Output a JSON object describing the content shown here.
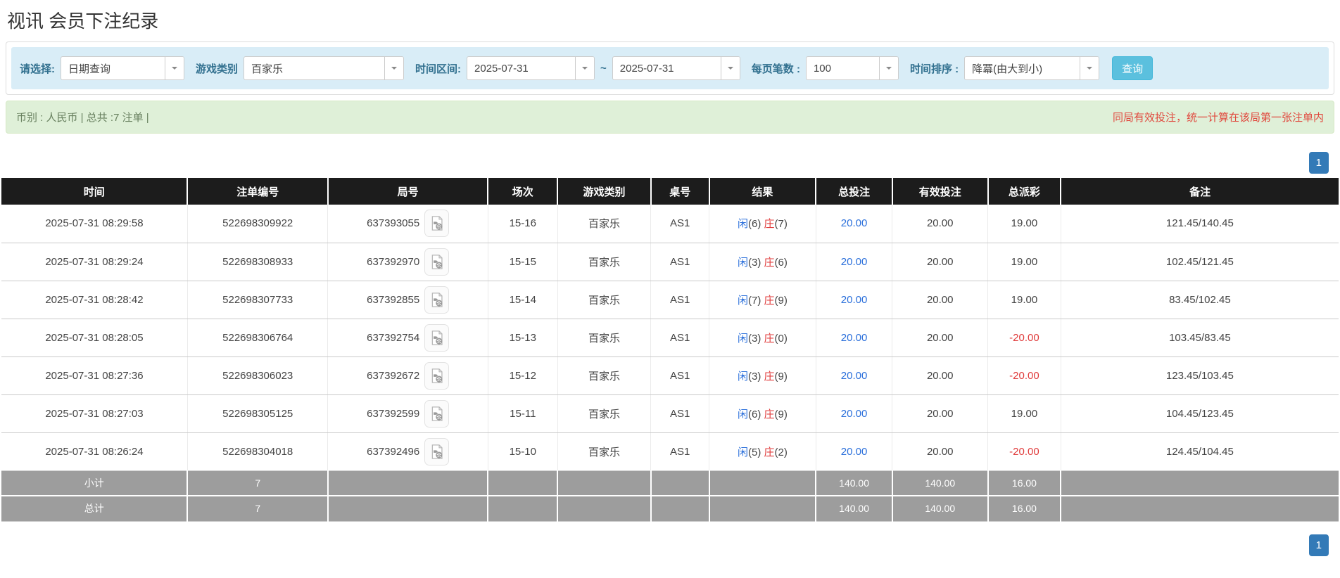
{
  "page": {
    "title": "视讯 会员下注纪录"
  },
  "filters": {
    "select_label": "请选择:",
    "select_value": "日期查询",
    "game_type_label": "游戏类别",
    "game_type_value": "百家乐",
    "time_range_label": "时间区间:",
    "time_from": "2025-07-31",
    "time_separator": "~",
    "time_to": "2025-07-31",
    "page_size_label": "每页笔数 :",
    "page_size_value": "100",
    "sort_label": "时间排序 :",
    "sort_value": "降冪(由大到小)",
    "search_button_label": "查询"
  },
  "summary_bar": {
    "left": "币别 : 人民币 | 总共 :7 注单 |",
    "right": "同局有效投注，统一计算在该局第一张注单内"
  },
  "pagination": {
    "page": "1"
  },
  "colors": {
    "accent_blue": "#337ab7",
    "info_bar_bg": "#d9edf7",
    "success_bar_bg": "#dff0d8",
    "query_button": "#5bc0de",
    "header_bg": "#1c1c1c",
    "summary_row_bg": "#9d9d9d",
    "player_blue": "#2a6fdb",
    "banker_red": "#e03c3c",
    "danger_text": "#e0483d"
  },
  "icons": {
    "select_caret": "caret-down-icon",
    "round_video": "video-record-icon"
  },
  "table": {
    "headers": [
      "时间",
      "注单编号",
      "局号",
      "场次",
      "游戏类别",
      "桌号",
      "结果",
      "总投注",
      "有效投注",
      "总派彩",
      "备注"
    ],
    "rows": [
      {
        "time": "2025-07-31 08:29:58",
        "bet_id": "522698309922",
        "round_id": "637393055",
        "session": "15-16",
        "game": "百家乐",
        "table_no": "AS1",
        "player": "闲",
        "player_n": "(6)",
        "banker": "庄",
        "banker_n": "(7)",
        "total_bet": "20.00",
        "valid_bet": "20.00",
        "payout": "19.00",
        "remark": "121.45/140.45"
      },
      {
        "time": "2025-07-31 08:29:24",
        "bet_id": "522698308933",
        "round_id": "637392970",
        "session": "15-15",
        "game": "百家乐",
        "table_no": "AS1",
        "player": "闲",
        "player_n": "(3)",
        "banker": "庄",
        "banker_n": "(6)",
        "total_bet": "20.00",
        "valid_bet": "20.00",
        "payout": "19.00",
        "remark": "102.45/121.45"
      },
      {
        "time": "2025-07-31 08:28:42",
        "bet_id": "522698307733",
        "round_id": "637392855",
        "session": "15-14",
        "game": "百家乐",
        "table_no": "AS1",
        "player": "闲",
        "player_n": "(7)",
        "banker": "庄",
        "banker_n": "(9)",
        "total_bet": "20.00",
        "valid_bet": "20.00",
        "payout": "19.00",
        "remark": "83.45/102.45"
      },
      {
        "time": "2025-07-31 08:28:05",
        "bet_id": "522698306764",
        "round_id": "637392754",
        "session": "15-13",
        "game": "百家乐",
        "table_no": "AS1",
        "player": "闲",
        "player_n": "(3)",
        "banker": "庄",
        "banker_n": "(0)",
        "total_bet": "20.00",
        "valid_bet": "20.00",
        "payout": "-20.00",
        "remark": "103.45/83.45"
      },
      {
        "time": "2025-07-31 08:27:36",
        "bet_id": "522698306023",
        "round_id": "637392672",
        "session": "15-12",
        "game": "百家乐",
        "table_no": "AS1",
        "player": "闲",
        "player_n": "(3)",
        "banker": "庄",
        "banker_n": "(9)",
        "total_bet": "20.00",
        "valid_bet": "20.00",
        "payout": "-20.00",
        "remark": "123.45/103.45"
      },
      {
        "time": "2025-07-31 08:27:03",
        "bet_id": "522698305125",
        "round_id": "637392599",
        "session": "15-11",
        "game": "百家乐",
        "table_no": "AS1",
        "player": "闲",
        "player_n": "(6)",
        "banker": "庄",
        "banker_n": "(9)",
        "total_bet": "20.00",
        "valid_bet": "20.00",
        "payout": "19.00",
        "remark": "104.45/123.45"
      },
      {
        "time": "2025-07-31 08:26:24",
        "bet_id": "522698304018",
        "round_id": "637392496",
        "session": "15-10",
        "game": "百家乐",
        "table_no": "AS1",
        "player": "闲",
        "player_n": "(5)",
        "banker": "庄",
        "banker_n": "(2)",
        "total_bet": "20.00",
        "valid_bet": "20.00",
        "payout": "-20.00",
        "remark": "124.45/104.45"
      }
    ],
    "subtotal": {
      "label": "小计",
      "count": "7",
      "total_bet": "140.00",
      "valid_bet": "140.00",
      "payout": "16.00"
    },
    "total": {
      "label": "总计",
      "count": "7",
      "total_bet": "140.00",
      "valid_bet": "140.00",
      "payout": "16.00"
    }
  }
}
